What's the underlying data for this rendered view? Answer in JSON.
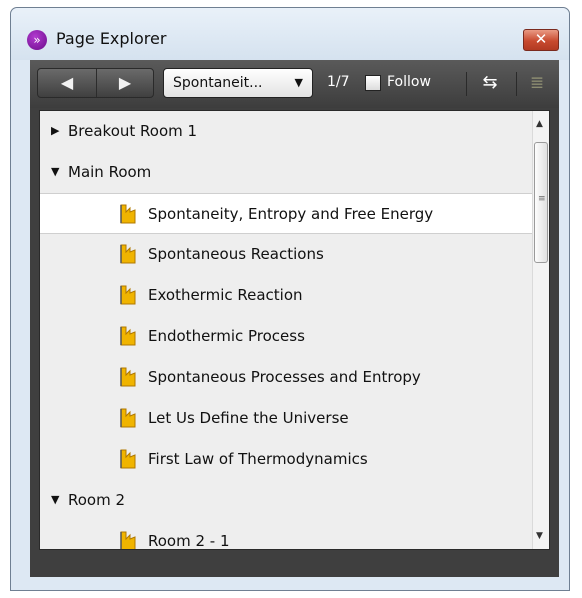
{
  "window": {
    "title": "Page Explorer",
    "close_glyph": "✕"
  },
  "toolbar": {
    "back_glyph": "◀",
    "forward_glyph": "▶",
    "page_select_value": "Spontaneit...",
    "page_select_caret": "▼",
    "page_count": "1/7",
    "follow_label": "Follow",
    "sync_glyph": "⇆",
    "list_glyph": "≣"
  },
  "tree": {
    "items": [
      {
        "type": "group",
        "expanded": false,
        "label": "Breakout Room 1"
      },
      {
        "type": "group",
        "expanded": true,
        "label": "Main Room"
      },
      {
        "type": "page",
        "selected": true,
        "label": "Spontaneity, Entropy and Free Energy"
      },
      {
        "type": "page",
        "label": "Spontaneous Reactions"
      },
      {
        "type": "page",
        "label": "Exothermic Reaction"
      },
      {
        "type": "page",
        "label": "Endothermic Process"
      },
      {
        "type": "page",
        "label": "Spontaneous Processes and Entropy"
      },
      {
        "type": "page",
        "label": "Let Us Define the Universe"
      },
      {
        "type": "page",
        "label": "First Law of Thermodynamics"
      },
      {
        "type": "group",
        "expanded": true,
        "label": "Room 2"
      },
      {
        "type": "page",
        "label": "Room 2 - 1"
      }
    ],
    "arrow_collapsed": "▶",
    "arrow_expanded": "▼"
  },
  "scrollbar": {
    "up_glyph": "▲",
    "down_glyph": "▼",
    "grip_glyph": "≡"
  },
  "colors": {
    "accent": "#7a1a9a",
    "close": "#c84a2f",
    "page_icon": "#f0b400"
  },
  "icons": {
    "app": "page-explorer-icon",
    "page": "page-document-icon"
  }
}
